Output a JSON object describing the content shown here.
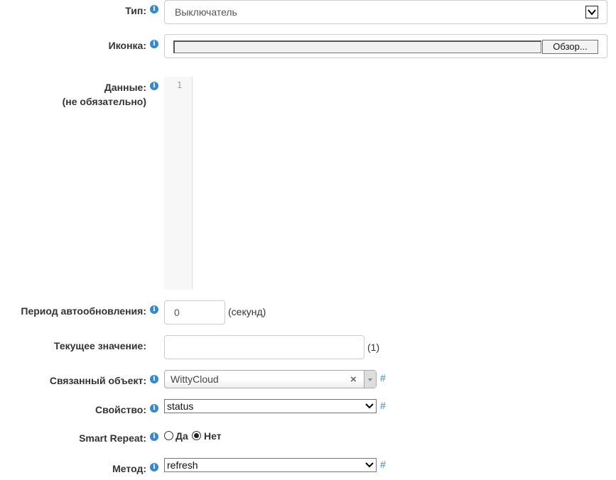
{
  "type_field": {
    "label": "Тип:",
    "value": "Выключатель"
  },
  "icon_field": {
    "label": "Иконка:",
    "browse_label": "Обзор..."
  },
  "data_field": {
    "label": "Данные:",
    "sublabel": "(не обязательно)",
    "line_number": "1"
  },
  "autoupdate_field": {
    "label": "Период автообновления:",
    "value": "0",
    "unit": "(секунд)"
  },
  "current_value_field": {
    "label": "Текущее значение:",
    "value": "",
    "note": "(1)"
  },
  "linked_object_field": {
    "label": "Связанный объект:",
    "value": "WittyCloud",
    "clear": "×",
    "link": "#"
  },
  "property_field": {
    "label": "Свойство:",
    "value": "status",
    "link": "#"
  },
  "smart_repeat_field": {
    "label": "Smart Repeat:",
    "option_yes": "Да",
    "option_no": "Нет",
    "selected": "Нет"
  },
  "method_field": {
    "label": "Метод:",
    "value": "refresh",
    "link": "#"
  },
  "info_glyph": "i",
  "colors": {
    "info_icon": "#3a87c8",
    "link": "#3a87c8",
    "border": "#cccccc",
    "editor_gutter": "#f7f7f7"
  }
}
